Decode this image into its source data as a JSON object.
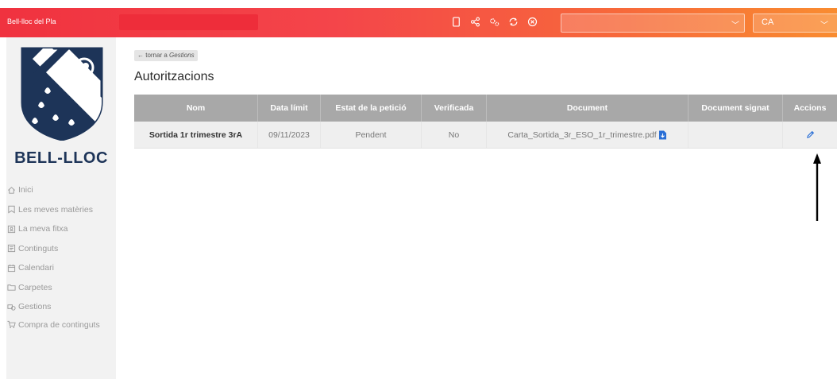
{
  "header": {
    "brand": "Bell-lloc del Pla",
    "icons": [
      "tablet-icon",
      "share-icon",
      "settings-icon",
      "sync-icon",
      "close-circle-icon"
    ],
    "user_select_value": "",
    "language": "CA"
  },
  "sidebar": {
    "logo_text": "BELL-LLOC",
    "items": [
      {
        "label": "Inici",
        "icon": "home-icon"
      },
      {
        "label": "Les meves matèries",
        "icon": "bookmark-icon"
      },
      {
        "label": "La meva fitxa",
        "icon": "id-card-icon"
      },
      {
        "label": "Continguts",
        "icon": "content-icon"
      },
      {
        "label": "Calendari",
        "icon": "calendar-icon"
      },
      {
        "label": "Carpetes",
        "icon": "folder-icon"
      },
      {
        "label": "Gestions",
        "icon": "gestions-icon"
      },
      {
        "label": "Compra de continguts",
        "icon": "cart-icon"
      }
    ]
  },
  "main": {
    "back_prefix": "← tornar a ",
    "back_target": "Gestions",
    "title": "Autoritzacions",
    "table": {
      "headers": [
        "Nom",
        "Data límit",
        "Estat de la petició",
        "Verificada",
        "Document",
        "Document signat",
        "Accions"
      ],
      "rows": [
        {
          "nom": "Sortida 1r trimestre 3rA",
          "data_limit": "09/11/2023",
          "estat": "Pendent",
          "verificada": "No",
          "document": "Carta_Sortida_3r_ESO_1r_trimestre.pdf",
          "document_signat": "",
          "accions": "edit-icon"
        }
      ]
    }
  },
  "colors": {
    "header_start": "#f0323f",
    "header_end": "#f98c30",
    "table_header": "#a8a8a8",
    "row_bg": "#efefef",
    "link_blue": "#2a6fd6",
    "logo_navy": "#1d3458"
  }
}
